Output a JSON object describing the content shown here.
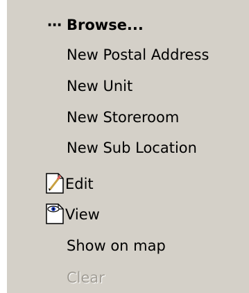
{
  "context_menu": {
    "items": [
      {
        "label": "Browse...",
        "prefix": "⋯",
        "bold": true,
        "enabled": true
      },
      {
        "label": "New Postal Address",
        "enabled": true
      },
      {
        "label": "New Unit",
        "enabled": true
      },
      {
        "label": "New Storeroom",
        "enabled": true
      },
      {
        "label": "New Sub Location",
        "enabled": true
      },
      {
        "label": "Edit",
        "icon": "edit-icon",
        "enabled": true
      },
      {
        "label": "View",
        "icon": "view-icon",
        "enabled": true
      },
      {
        "label": "Show on map",
        "enabled": true
      },
      {
        "label": "Clear",
        "enabled": false
      }
    ]
  },
  "colors": {
    "menu_background": "#d4d0c8",
    "text": "#000000",
    "disabled_text": "#a09c94"
  }
}
